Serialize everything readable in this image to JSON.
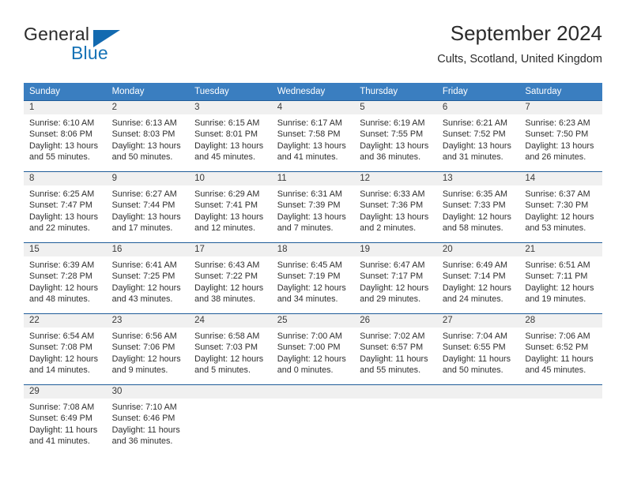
{
  "brand": {
    "name_part1": "General",
    "name_part2": "Blue",
    "flag_icon": "triangle-flag-icon"
  },
  "header": {
    "title": "September 2024",
    "subtitle": "Cults, Scotland, United Kingdom"
  },
  "colors": {
    "header_blue": "#3a7ec0",
    "row_border_blue": "#1f5c99",
    "daynum_band": "#f0f0f0",
    "brand_blue": "#1572b6"
  },
  "weekday_headers": [
    "Sunday",
    "Monday",
    "Tuesday",
    "Wednesday",
    "Thursday",
    "Friday",
    "Saturday"
  ],
  "weeks": [
    [
      {
        "day": "1",
        "sunrise": "Sunrise: 6:10 AM",
        "sunset": "Sunset: 8:06 PM",
        "daylight_line1": "Daylight: 13 hours",
        "daylight_line2": "and 55 minutes."
      },
      {
        "day": "2",
        "sunrise": "Sunrise: 6:13 AM",
        "sunset": "Sunset: 8:03 PM",
        "daylight_line1": "Daylight: 13 hours",
        "daylight_line2": "and 50 minutes."
      },
      {
        "day": "3",
        "sunrise": "Sunrise: 6:15 AM",
        "sunset": "Sunset: 8:01 PM",
        "daylight_line1": "Daylight: 13 hours",
        "daylight_line2": "and 45 minutes."
      },
      {
        "day": "4",
        "sunrise": "Sunrise: 6:17 AM",
        "sunset": "Sunset: 7:58 PM",
        "daylight_line1": "Daylight: 13 hours",
        "daylight_line2": "and 41 minutes."
      },
      {
        "day": "5",
        "sunrise": "Sunrise: 6:19 AM",
        "sunset": "Sunset: 7:55 PM",
        "daylight_line1": "Daylight: 13 hours",
        "daylight_line2": "and 36 minutes."
      },
      {
        "day": "6",
        "sunrise": "Sunrise: 6:21 AM",
        "sunset": "Sunset: 7:52 PM",
        "daylight_line1": "Daylight: 13 hours",
        "daylight_line2": "and 31 minutes."
      },
      {
        "day": "7",
        "sunrise": "Sunrise: 6:23 AM",
        "sunset": "Sunset: 7:50 PM",
        "daylight_line1": "Daylight: 13 hours",
        "daylight_line2": "and 26 minutes."
      }
    ],
    [
      {
        "day": "8",
        "sunrise": "Sunrise: 6:25 AM",
        "sunset": "Sunset: 7:47 PM",
        "daylight_line1": "Daylight: 13 hours",
        "daylight_line2": "and 22 minutes."
      },
      {
        "day": "9",
        "sunrise": "Sunrise: 6:27 AM",
        "sunset": "Sunset: 7:44 PM",
        "daylight_line1": "Daylight: 13 hours",
        "daylight_line2": "and 17 minutes."
      },
      {
        "day": "10",
        "sunrise": "Sunrise: 6:29 AM",
        "sunset": "Sunset: 7:41 PM",
        "daylight_line1": "Daylight: 13 hours",
        "daylight_line2": "and 12 minutes."
      },
      {
        "day": "11",
        "sunrise": "Sunrise: 6:31 AM",
        "sunset": "Sunset: 7:39 PM",
        "daylight_line1": "Daylight: 13 hours",
        "daylight_line2": "and 7 minutes."
      },
      {
        "day": "12",
        "sunrise": "Sunrise: 6:33 AM",
        "sunset": "Sunset: 7:36 PM",
        "daylight_line1": "Daylight: 13 hours",
        "daylight_line2": "and 2 minutes."
      },
      {
        "day": "13",
        "sunrise": "Sunrise: 6:35 AM",
        "sunset": "Sunset: 7:33 PM",
        "daylight_line1": "Daylight: 12 hours",
        "daylight_line2": "and 58 minutes."
      },
      {
        "day": "14",
        "sunrise": "Sunrise: 6:37 AM",
        "sunset": "Sunset: 7:30 PM",
        "daylight_line1": "Daylight: 12 hours",
        "daylight_line2": "and 53 minutes."
      }
    ],
    [
      {
        "day": "15",
        "sunrise": "Sunrise: 6:39 AM",
        "sunset": "Sunset: 7:28 PM",
        "daylight_line1": "Daylight: 12 hours",
        "daylight_line2": "and 48 minutes."
      },
      {
        "day": "16",
        "sunrise": "Sunrise: 6:41 AM",
        "sunset": "Sunset: 7:25 PM",
        "daylight_line1": "Daylight: 12 hours",
        "daylight_line2": "and 43 minutes."
      },
      {
        "day": "17",
        "sunrise": "Sunrise: 6:43 AM",
        "sunset": "Sunset: 7:22 PM",
        "daylight_line1": "Daylight: 12 hours",
        "daylight_line2": "and 38 minutes."
      },
      {
        "day": "18",
        "sunrise": "Sunrise: 6:45 AM",
        "sunset": "Sunset: 7:19 PM",
        "daylight_line1": "Daylight: 12 hours",
        "daylight_line2": "and 34 minutes."
      },
      {
        "day": "19",
        "sunrise": "Sunrise: 6:47 AM",
        "sunset": "Sunset: 7:17 PM",
        "daylight_line1": "Daylight: 12 hours",
        "daylight_line2": "and 29 minutes."
      },
      {
        "day": "20",
        "sunrise": "Sunrise: 6:49 AM",
        "sunset": "Sunset: 7:14 PM",
        "daylight_line1": "Daylight: 12 hours",
        "daylight_line2": "and 24 minutes."
      },
      {
        "day": "21",
        "sunrise": "Sunrise: 6:51 AM",
        "sunset": "Sunset: 7:11 PM",
        "daylight_line1": "Daylight: 12 hours",
        "daylight_line2": "and 19 minutes."
      }
    ],
    [
      {
        "day": "22",
        "sunrise": "Sunrise: 6:54 AM",
        "sunset": "Sunset: 7:08 PM",
        "daylight_line1": "Daylight: 12 hours",
        "daylight_line2": "and 14 minutes."
      },
      {
        "day": "23",
        "sunrise": "Sunrise: 6:56 AM",
        "sunset": "Sunset: 7:06 PM",
        "daylight_line1": "Daylight: 12 hours",
        "daylight_line2": "and 9 minutes."
      },
      {
        "day": "24",
        "sunrise": "Sunrise: 6:58 AM",
        "sunset": "Sunset: 7:03 PM",
        "daylight_line1": "Daylight: 12 hours",
        "daylight_line2": "and 5 minutes."
      },
      {
        "day": "25",
        "sunrise": "Sunrise: 7:00 AM",
        "sunset": "Sunset: 7:00 PM",
        "daylight_line1": "Daylight: 12 hours",
        "daylight_line2": "and 0 minutes."
      },
      {
        "day": "26",
        "sunrise": "Sunrise: 7:02 AM",
        "sunset": "Sunset: 6:57 PM",
        "daylight_line1": "Daylight: 11 hours",
        "daylight_line2": "and 55 minutes."
      },
      {
        "day": "27",
        "sunrise": "Sunrise: 7:04 AM",
        "sunset": "Sunset: 6:55 PM",
        "daylight_line1": "Daylight: 11 hours",
        "daylight_line2": "and 50 minutes."
      },
      {
        "day": "28",
        "sunrise": "Sunrise: 7:06 AM",
        "sunset": "Sunset: 6:52 PM",
        "daylight_line1": "Daylight: 11 hours",
        "daylight_line2": "and 45 minutes."
      }
    ],
    [
      {
        "day": "29",
        "sunrise": "Sunrise: 7:08 AM",
        "sunset": "Sunset: 6:49 PM",
        "daylight_line1": "Daylight: 11 hours",
        "daylight_line2": "and 41 minutes."
      },
      {
        "day": "30",
        "sunrise": "Sunrise: 7:10 AM",
        "sunset": "Sunset: 6:46 PM",
        "daylight_line1": "Daylight: 11 hours",
        "daylight_line2": "and 36 minutes."
      },
      {
        "day": "",
        "sunrise": "",
        "sunset": "",
        "daylight_line1": "",
        "daylight_line2": ""
      },
      {
        "day": "",
        "sunrise": "",
        "sunset": "",
        "daylight_line1": "",
        "daylight_line2": ""
      },
      {
        "day": "",
        "sunrise": "",
        "sunset": "",
        "daylight_line1": "",
        "daylight_line2": ""
      },
      {
        "day": "",
        "sunrise": "",
        "sunset": "",
        "daylight_line1": "",
        "daylight_line2": ""
      },
      {
        "day": "",
        "sunrise": "",
        "sunset": "",
        "daylight_line1": "",
        "daylight_line2": ""
      }
    ]
  ]
}
